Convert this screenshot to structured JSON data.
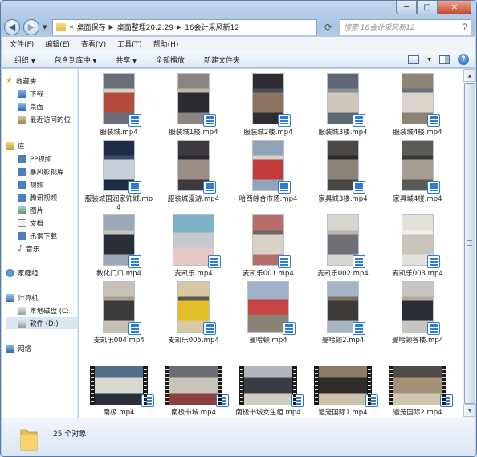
{
  "window": {
    "caption": {
      "minimize": "─",
      "maximize": "□",
      "close": "✕"
    }
  },
  "address": {
    "crumbs": [
      "«",
      "桌面保存",
      "桌面整理20.2.29",
      "16会计采风新12"
    ],
    "search_placeholder": "搜索 16会计采风新12"
  },
  "menu": [
    "文件(F)",
    "编辑(E)",
    "查看(V)",
    "工具(T)",
    "帮助(H)"
  ],
  "toolbar": [
    "组织",
    "包含到库中",
    "共享",
    "全部播放",
    "新建文件夹"
  ],
  "sidebar": {
    "favorites_title": "收藏夹",
    "favorites": [
      "下载",
      "桌面",
      "最近访问的位"
    ],
    "libraries_title": "库",
    "libraries": [
      "PP视频",
      "暴风影视库",
      "视频",
      "腾讯视频",
      "图片",
      "文档",
      "迅雷下载",
      "音乐"
    ],
    "homegroup": "家庭组",
    "computer_title": "计算机",
    "drives": [
      "本地磁盘 (C:",
      "软件 (D:)"
    ],
    "network": "网络"
  },
  "files": [
    {
      "name": "服装城.mp4",
      "shape": "portrait",
      "colors": [
        "#6b6e78",
        "#b54a3e",
        "#d8d2c8"
      ]
    },
    {
      "name": "服装城1楼.mp4",
      "shape": "portrait",
      "colors": [
        "#8a8580",
        "#2c2b30",
        "#c0b7ad"
      ]
    },
    {
      "name": "服装城2楼.mp4",
      "shape": "portrait",
      "colors": [
        "#2f2c33",
        "#8b7462",
        "#4a4b55"
      ]
    },
    {
      "name": "服装城3楼.mp4",
      "shape": "portrait",
      "colors": [
        "#5f6773",
        "#cfc7bb",
        "#8a8f9b"
      ]
    },
    {
      "name": "服装城4楼.mp4",
      "shape": "portrait",
      "colors": [
        "#8e8476",
        "#d9d3ca",
        "#6b6f7a"
      ]
    },
    {
      "name": "服装城国润家饰城.mp4",
      "shape": "portrait",
      "colors": [
        "#1f2a44",
        "#c9cfd9",
        "#3c4a66"
      ]
    },
    {
      "name": "服装城漫游.mp4",
      "shape": "portrait",
      "colors": [
        "#3e3a40",
        "#9a8f86",
        "#2b2a2f"
      ]
    },
    {
      "name": "哈西综合市场.mp4",
      "shape": "portrait",
      "colors": [
        "#8fa4b8",
        "#c33c3c",
        "#d6d0c5"
      ]
    },
    {
      "name": "家具城3楼.mp4",
      "shape": "portrait",
      "colors": [
        "#4a4844",
        "#8b8478",
        "#2f2d2b"
      ]
    },
    {
      "name": "家具城4楼.mp4",
      "shape": "portrait",
      "colors": [
        "#5b5a58",
        "#a49d92",
        "#3a3936"
      ]
    },
    {
      "name": "教化门口.mp4",
      "shape": "portrait",
      "colors": [
        "#9ba8b6",
        "#2b2e36",
        "#c9c4b8"
      ]
    },
    {
      "name": "麦凯乐.mp4",
      "shape": "landscape-thumb",
      "colors": [
        "#7eb0c8",
        "#c4c9ce",
        "#e6c9c5"
      ]
    },
    {
      "name": "麦凯乐001.mp4",
      "shape": "portrait",
      "colors": [
        "#b86d6a",
        "#d9d2c9",
        "#6c6866"
      ]
    },
    {
      "name": "麦凯乐002.mp4",
      "shape": "portrait",
      "colors": [
        "#d7d4cf",
        "#6e7075",
        "#b9b5ae"
      ]
    },
    {
      "name": "麦凯乐003.mp4",
      "shape": "portrait",
      "colors": [
        "#e3e0db",
        "#c9c3ba",
        "#f1efeb"
      ]
    },
    {
      "name": "麦凯乐004.mp4",
      "shape": "portrait",
      "colors": [
        "#c7c0b4",
        "#3b3a3d",
        "#a69e92"
      ]
    },
    {
      "name": "麦凯乐005.mp4",
      "shape": "portrait",
      "colors": [
        "#d7c9a2",
        "#e3bf2b",
        "#5a5650"
      ]
    },
    {
      "name": "曼哈顿.mp4",
      "shape": "landscape-thumb",
      "colors": [
        "#9fb2c8",
        "#c94444",
        "#8a8275"
      ]
    },
    {
      "name": "曼哈顿2.mp4",
      "shape": "portrait",
      "colors": [
        "#a5b3c2",
        "#3d3a38",
        "#7a6f62"
      ]
    },
    {
      "name": "曼哈顿各楼.mp4",
      "shape": "portrait",
      "colors": [
        "#c8c5c0",
        "#2c2e35",
        "#b0aaa0"
      ]
    },
    {
      "name": "南极.mp4",
      "shape": "film",
      "colors": [
        "#536e88",
        "#d8d8d2",
        "#2b2f3a"
      ]
    },
    {
      "name": "南极书城.mp4",
      "shape": "film",
      "colors": [
        "#6b6d73",
        "#c9c4bb",
        "#8e3f3f"
      ]
    },
    {
      "name": "南极书城女生组.mp4",
      "shape": "film",
      "colors": [
        "#b3b7bd",
        "#3a3c44",
        "#d2cdc4"
      ]
    },
    {
      "name": "逅笼国际1.mp4",
      "shape": "film",
      "colors": [
        "#8c7a64",
        "#2f2c2a",
        "#cbbfae"
      ]
    },
    {
      "name": "逅笼国际2.mp4",
      "shape": "film",
      "colors": [
        "#4d4a48",
        "#a39276",
        "#d1c6b3"
      ]
    }
  ],
  "status": {
    "count_text": "25 个对象"
  }
}
